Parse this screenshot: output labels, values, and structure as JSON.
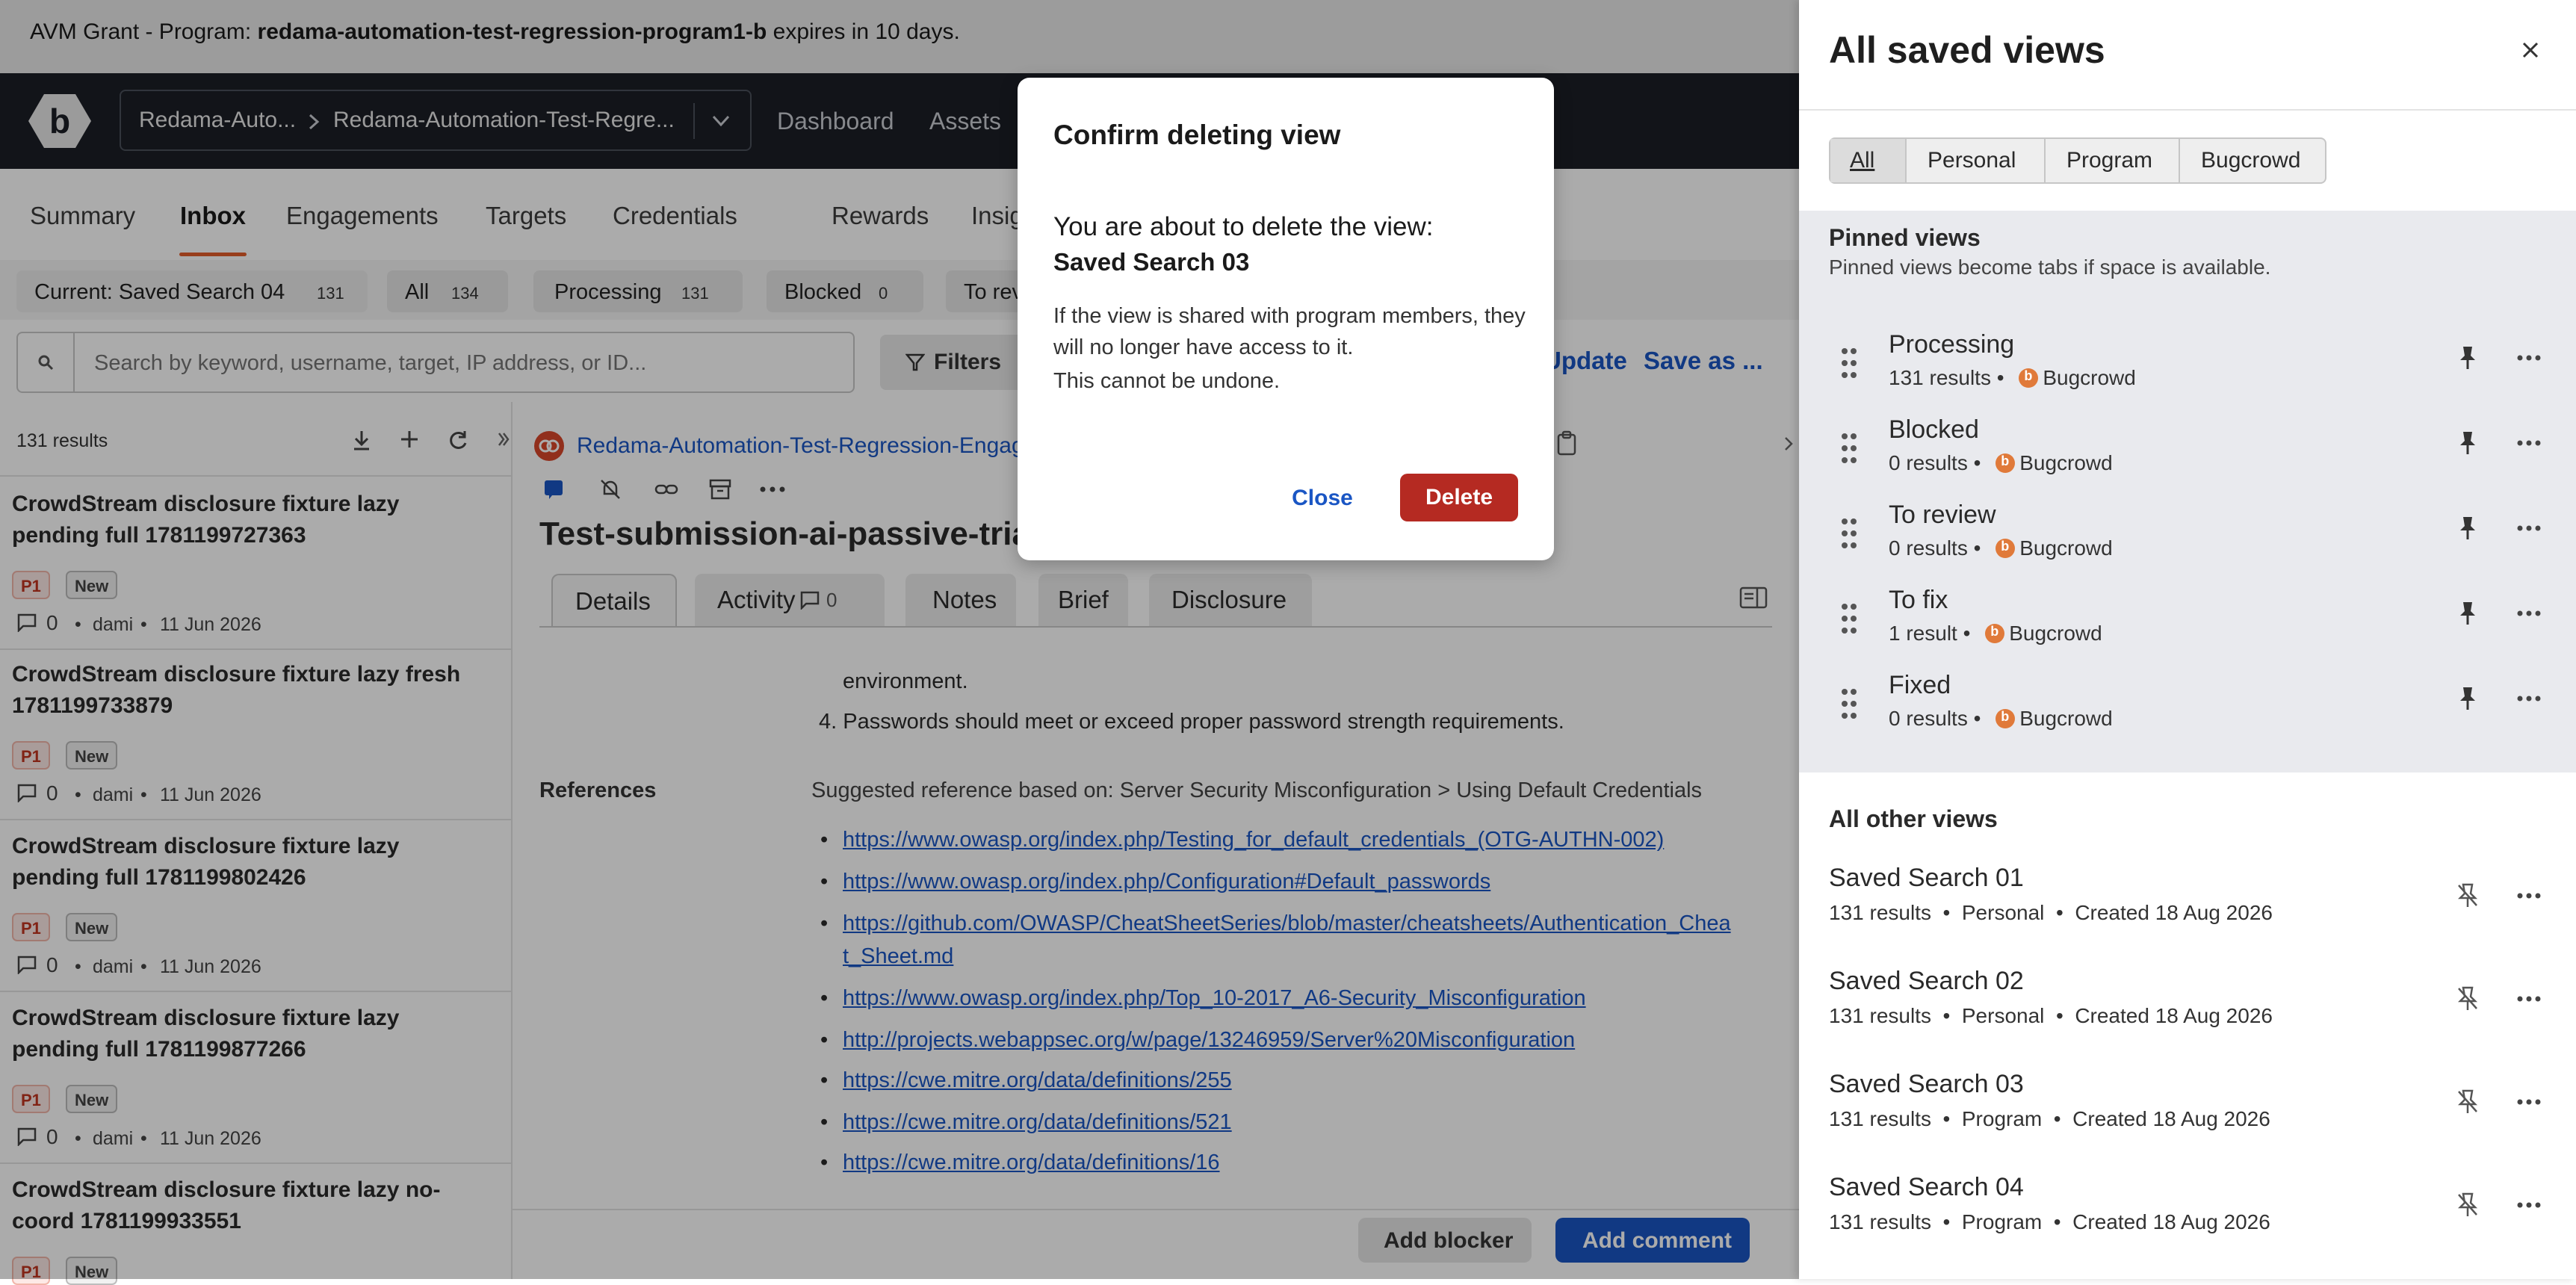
{
  "banner": {
    "prefix": "AVM Grant - Program: ",
    "program": "redama-automation-test-regression-program1-b",
    "suffix": " expires in 10 days."
  },
  "topnav": {
    "crumb1": "Redama-Auto...",
    "crumb2": "Redama-Automation-Test-Regre...",
    "links": [
      "Dashboard",
      "Assets"
    ]
  },
  "subtabs": [
    "Summary",
    "Inbox",
    "Engagements",
    "Targets",
    "Credentials",
    "Rewards",
    "Insights"
  ],
  "viewbar": {
    "current": {
      "label": "Current: Saved Search 04",
      "count": "131"
    },
    "all": {
      "label": "All",
      "count": "134"
    },
    "processing": {
      "label": "Processing",
      "count": "131"
    },
    "blocked": {
      "label": "Blocked",
      "count": "0"
    },
    "toreview": {
      "label": "To rev"
    }
  },
  "search": {
    "placeholder": "Search by keyword, username, target, IP address, or ID...",
    "filters": "Filters",
    "update": "Update",
    "save_as": "Save as ..."
  },
  "left": {
    "results": "131 results",
    "items": [
      {
        "title": "CrowdStream disclosure fixture lazy pending full 1781199727363",
        "p": "P1",
        "status": "New",
        "comments": "0",
        "user": "dami",
        "date": "11 Jun 2026"
      },
      {
        "title": "CrowdStream disclosure fixture lazy fresh 1781199733879",
        "p": "P1",
        "status": "New",
        "comments": "0",
        "user": "dami",
        "date": "11 Jun 2026"
      },
      {
        "title": "CrowdStream disclosure fixture lazy pending full 1781199802426",
        "p": "P1",
        "status": "New",
        "comments": "0",
        "user": "dami",
        "date": "11 Jun 2026"
      },
      {
        "title": "CrowdStream disclosure fixture lazy pending full 1781199877266",
        "p": "P1",
        "status": "New",
        "comments": "0",
        "user": "dami",
        "date": "11 Jun 2026"
      },
      {
        "title": "CrowdStream disclosure fixture lazy no-coord 1781199933551",
        "p": "P1",
        "status": "New",
        "comments": "",
        "user": "",
        "date": ""
      }
    ]
  },
  "middle": {
    "engagement": "Redama-Automation-Test-Regression-Engag",
    "title": "Test-submission-ai-passive-tria",
    "tabs": [
      "Details",
      "Activity",
      "Notes",
      "Brief",
      "Disclosure"
    ],
    "activity_count": "0",
    "env_text": "environment.",
    "list_item": "4. Passwords should meet or exceed proper password strength requirements.",
    "references_label": "References",
    "suggested": "Suggested reference based on: Server Security Misconfiguration > Using Default Credentials",
    "refs": [
      "https://www.owasp.org/index.php/Testing_for_default_credentials_(OTG-AUTHN-002)",
      "https://www.owasp.org/index.php/Configuration#Default_passwords",
      "https://github.com/OWASP/CheatSheetSeries/blob/master/cheatsheets/Authentication_Chea",
      "t_Sheet.md",
      "https://www.owasp.org/index.php/Top_10-2017_A6-Security_Misconfiguration",
      "http://projects.webappsec.org/w/page/13246959/Server%20Misconfiguration",
      "https://cwe.mitre.org/data/definitions/255",
      "https://cwe.mitre.org/data/definitions/521",
      "https://cwe.mitre.org/data/definitions/16"
    ],
    "add_blocker": "Add blocker",
    "add_comment": "Add comment"
  },
  "drawer": {
    "title": "All saved views",
    "segments": [
      "All",
      "Personal",
      "Program",
      "Bugcrowd"
    ],
    "pinned_heading": "Pinned views",
    "pinned_sub": "Pinned views become tabs if space is available.",
    "pinned": [
      {
        "name": "Processing",
        "results": "131 results",
        "owner": "Bugcrowd"
      },
      {
        "name": "Blocked",
        "results": "0 results",
        "owner": "Bugcrowd"
      },
      {
        "name": "To review",
        "results": "0 results",
        "owner": "Bugcrowd"
      },
      {
        "name": "To fix",
        "results": "1 result",
        "owner": "Bugcrowd"
      },
      {
        "name": "Fixed",
        "results": "0 results",
        "owner": "Bugcrowd"
      }
    ],
    "other_heading": "All other views",
    "other": [
      {
        "name": "Saved Search 01",
        "meta": "131 results  •  Personal  •  Created 18 Aug 2026"
      },
      {
        "name": "Saved Search 02",
        "meta": "131 results  •  Personal  •  Created 18 Aug 2026"
      },
      {
        "name": "Saved Search 03",
        "meta": "131 results  •  Program  •  Created 18 Aug 2026"
      },
      {
        "name": "Saved Search 04",
        "meta": "131 results  •  Program  •  Created 18 Aug 2026"
      }
    ]
  },
  "modal": {
    "title": "Confirm deleting view",
    "line1": "You are about to delete the view:",
    "view_name": "Saved Search 03",
    "line3": "If the view is shared with program members, they will no longer have access to it.",
    "line4": "This cannot be undone.",
    "close": "Close",
    "delete": "Delete"
  },
  "colors": {
    "accent": "#e35d2a",
    "link": "#1a56c4",
    "danger": "#b52a22",
    "nav": "#1c1f26"
  }
}
